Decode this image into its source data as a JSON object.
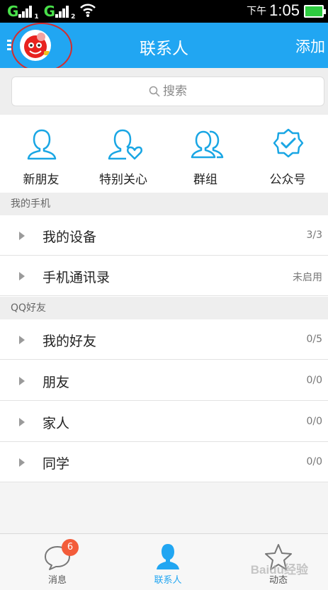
{
  "status_bar": {
    "carrier1": "G",
    "carrier1_sub": "1",
    "carrier2": "G",
    "carrier2_sub": "2",
    "time_prefix": "下午",
    "time": "1:05"
  },
  "header": {
    "title": "联系人",
    "add_label": "添加"
  },
  "search": {
    "placeholder": "搜索"
  },
  "quick_entries": [
    {
      "label": "新朋友",
      "icon": "new-friend-icon"
    },
    {
      "label": "特别关心",
      "icon": "special-care-icon"
    },
    {
      "label": "群组",
      "icon": "group-icon"
    },
    {
      "label": "公众号",
      "icon": "official-account-icon"
    }
  ],
  "sections": [
    {
      "title": "我的手机",
      "rows": [
        {
          "label": "我的设备",
          "count": "3/3"
        },
        {
          "label": "手机通讯录",
          "count": "未启用"
        }
      ]
    },
    {
      "title": "QQ好友",
      "rows": [
        {
          "label": "我的好友",
          "count": "0/5"
        },
        {
          "label": "朋友",
          "count": "0/0"
        },
        {
          "label": "家人",
          "count": "0/0"
        },
        {
          "label": "同学",
          "count": "0/0"
        }
      ]
    }
  ],
  "bottom_nav": {
    "items": [
      {
        "label": "消息",
        "icon": "message-icon",
        "badge": "6"
      },
      {
        "label": "联系人",
        "icon": "contacts-icon"
      },
      {
        "label": "动态",
        "icon": "star-icon"
      }
    ]
  },
  "watermark": "Baidu经验",
  "colors": {
    "accent": "#21a6f2",
    "badge": "#f35c3a",
    "highlight_ring": "#d62b2b"
  }
}
